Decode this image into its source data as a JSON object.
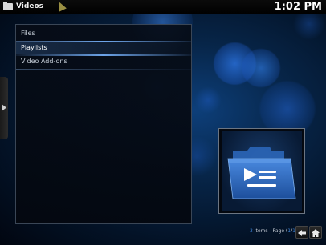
{
  "header": {
    "section_title": "Videos",
    "clock": "1:02 PM"
  },
  "menu": {
    "items": [
      {
        "label": "Files"
      },
      {
        "label": "Playlists"
      },
      {
        "label": "Video Add-ons"
      }
    ],
    "selected_index": 1
  },
  "footer": {
    "count": "3",
    "items_text": " Items - Page (",
    "page_current": "1",
    "page_separator": "/",
    "page_total": "1",
    "page_close": ")"
  },
  "icons": {
    "section": "folder-icon",
    "side_tab": "arrow-right-icon",
    "thumbnail": "playlist-folder-icon",
    "back": "back-arrow-icon",
    "home": "home-icon"
  },
  "colors": {
    "accent": "#3b82d6",
    "background": "#072548",
    "folder_blue": "#2f6cc4"
  }
}
